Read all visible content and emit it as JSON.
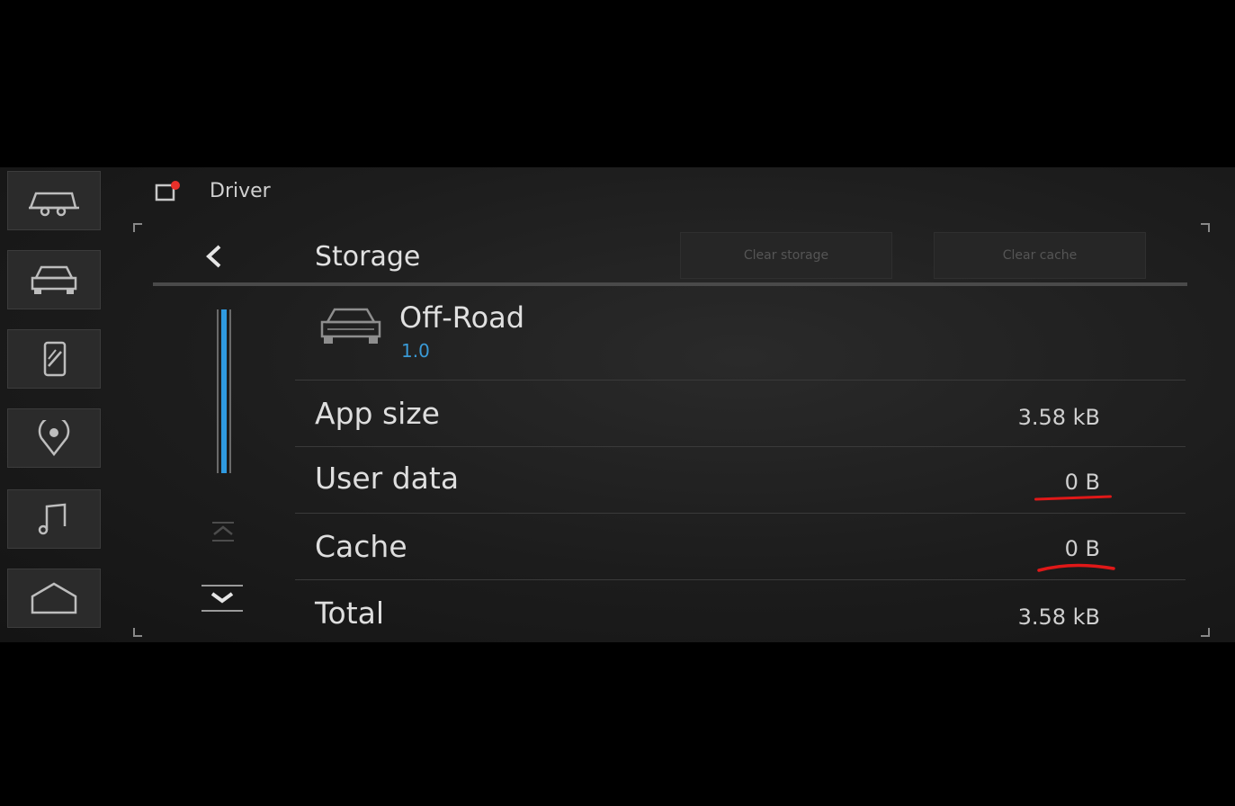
{
  "header": {
    "title": "Driver"
  },
  "rail": {
    "items": [
      {
        "icon": "trailer-icon"
      },
      {
        "icon": "car-front-icon"
      },
      {
        "icon": "phone-icon"
      },
      {
        "icon": "location-pin-icon"
      },
      {
        "icon": "music-note-icon"
      },
      {
        "icon": "home-icon"
      }
    ]
  },
  "page": {
    "back_icon": "back-chevron-icon",
    "title": "Storage",
    "clear_storage_label": "Clear storage",
    "clear_cache_label": "Clear cache"
  },
  "app": {
    "icon": "car-front-icon",
    "name": "Off-Road",
    "version": "1.0"
  },
  "rows": [
    {
      "label": "App size",
      "value": "3.58 kB"
    },
    {
      "label": "User data",
      "value": "0 B"
    },
    {
      "label": "Cache",
      "value": "0 B"
    },
    {
      "label": "Total",
      "value": "3.58 kB"
    }
  ],
  "colors": {
    "accent": "#3a9ad6",
    "annotation": "#e01818",
    "alert": "#e8302a"
  }
}
